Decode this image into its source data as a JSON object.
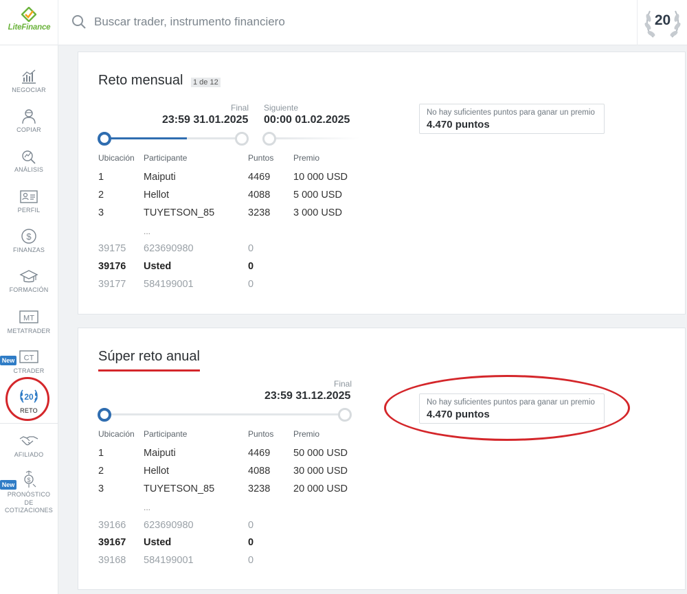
{
  "header": {
    "logo_text": "LiteFinance",
    "search_placeholder": "Buscar trader, instrumento financiero",
    "badge_number": "20"
  },
  "sidebar": {
    "items": [
      {
        "label": "NEGOCIAR",
        "icon": "chart-icon"
      },
      {
        "label": "COPIAR",
        "icon": "user-icon"
      },
      {
        "label": "ANÁLISIS",
        "icon": "analysis-icon"
      },
      {
        "label": "PERFIL",
        "icon": "profile-card-icon"
      },
      {
        "label": "FINANZAS",
        "icon": "dollar-icon"
      },
      {
        "label": "FORMACIÓN",
        "icon": "graduation-cap-icon"
      },
      {
        "label": "METATRADER",
        "icon": "mt-icon",
        "icon_text": "MT"
      },
      {
        "label": "CTRADER",
        "icon": "ct-icon",
        "icon_text": "CT",
        "tag": "New"
      },
      {
        "label": "RETO",
        "icon": "laurel-20-icon",
        "icon_text": "20",
        "active": true
      },
      {
        "label": "AFILIADO",
        "icon": "handshake-icon"
      },
      {
        "label": "PRONÓSTICO DE COTIZACIONES",
        "label_lines": [
          "PRONÓSTICO",
          "DE",
          "COTIZACIONES"
        ],
        "icon": "forecast-icon",
        "tag": "New"
      }
    ]
  },
  "monthly": {
    "title": "Reto mensual",
    "counter": "1 de 12",
    "final_label": "Final",
    "final_date": "23:59 31.01.2025",
    "next_label": "Siguiente",
    "next_date": "00:00 01.02.2025",
    "progress": 0.6,
    "info_message": "No hay suficientes puntos para ganar un premio",
    "info_points": "4.470 puntos",
    "columns": [
      "Ubicación",
      "Participante",
      "Puntos",
      "Premio"
    ],
    "top_rows": [
      {
        "pos": "1",
        "name": "Maiputi",
        "points": "4469",
        "prize": "10 000 USD"
      },
      {
        "pos": "2",
        "name": "Hellot",
        "points": "4088",
        "prize": "5 000 USD"
      },
      {
        "pos": "3",
        "name": "TUYETSON_85",
        "points": "3238",
        "prize": "3 000 USD"
      }
    ],
    "ellipsis": "...",
    "near_rows": [
      {
        "pos": "39175",
        "name": "623690980",
        "points": "0",
        "style": "muted"
      },
      {
        "pos": "39176",
        "name": "Usted",
        "points": "0",
        "style": "bold"
      },
      {
        "pos": "39177",
        "name": "584199001",
        "points": "0",
        "style": "muted"
      }
    ]
  },
  "annual": {
    "title": "Súper reto anual",
    "final_label": "Final",
    "final_date": "23:59 31.12.2025",
    "info_message": "No hay suficientes puntos para ganar un premio",
    "info_points": "4.470 puntos",
    "columns": [
      "Ubicación",
      "Participante",
      "Puntos",
      "Premio"
    ],
    "top_rows": [
      {
        "pos": "1",
        "name": "Maiputi",
        "points": "4469",
        "prize": "50 000 USD"
      },
      {
        "pos": "2",
        "name": "Hellot",
        "points": "4088",
        "prize": "30 000 USD"
      },
      {
        "pos": "3",
        "name": "TUYETSON_85",
        "points": "3238",
        "prize": "20 000 USD"
      }
    ],
    "ellipsis": "...",
    "near_rows": [
      {
        "pos": "39166",
        "name": "623690980",
        "points": "0",
        "style": "muted"
      },
      {
        "pos": "39167",
        "name": "Usted",
        "points": "0",
        "style": "bold"
      },
      {
        "pos": "39168",
        "name": "584199001",
        "points": "0",
        "style": "muted"
      }
    ]
  },
  "colors": {
    "accent_blue": "#2f6db0",
    "annotation_red": "#d4262a",
    "brand_green": "#6bb33c"
  }
}
